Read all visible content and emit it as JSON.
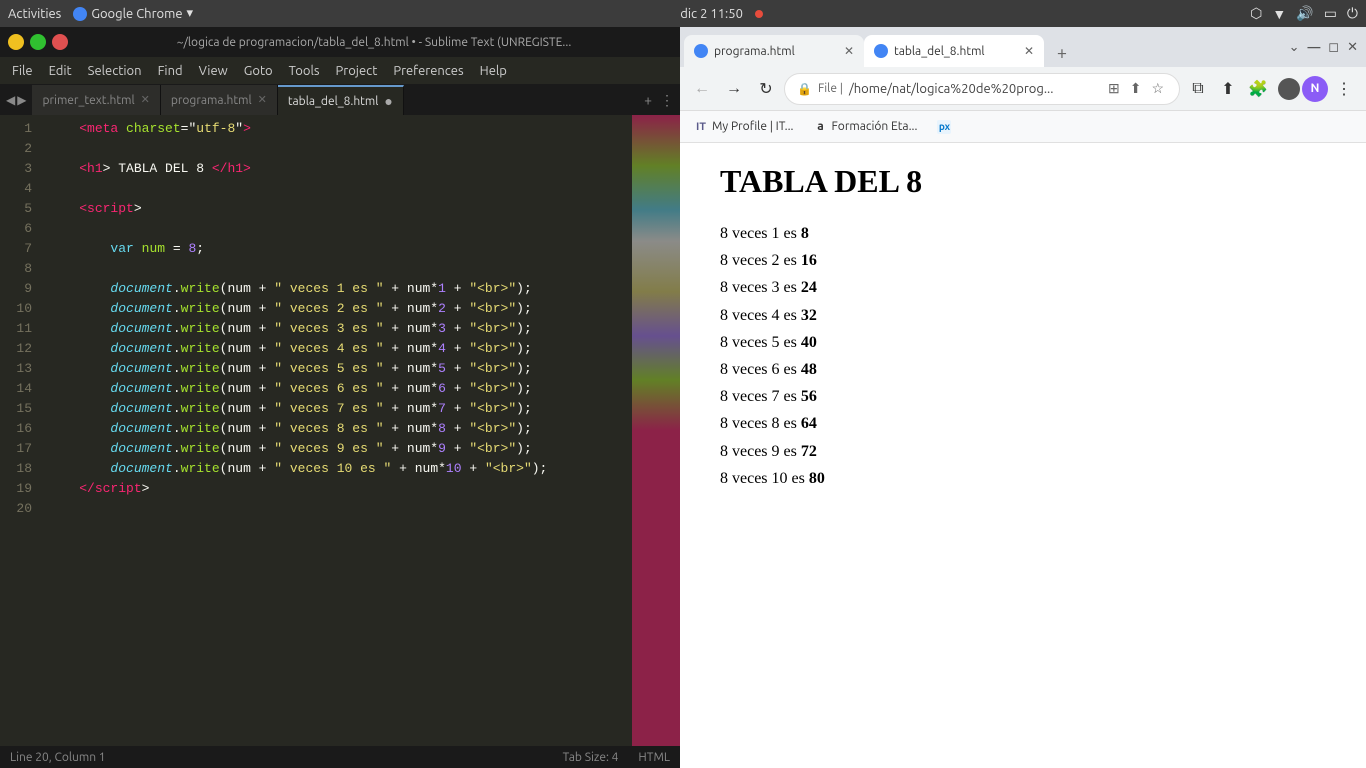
{
  "system_bar": {
    "activities": "Activities",
    "app_name": "Google Chrome",
    "dropdown_icon": "▾",
    "datetime": "dic 2  11:50",
    "icons_right": [
      "dropbox",
      "wifi",
      "volume",
      "screen",
      "power"
    ]
  },
  "sublime": {
    "title": "~/logica de programacion/tabla_del_8.html • - Sublime Text (UNREGISTE...",
    "tabs": [
      {
        "name": "primer_text.html",
        "active": false,
        "unsaved": false
      },
      {
        "name": "programa.html",
        "active": false,
        "unsaved": false
      },
      {
        "name": "tabla_del_8.html",
        "active": true,
        "unsaved": true
      }
    ],
    "menu_items": [
      "File",
      "Edit",
      "Selection",
      "Find",
      "View",
      "Goto",
      "Tools",
      "Project",
      "Preferences",
      "Help"
    ],
    "lines": [
      {
        "num": 1,
        "code": [
          {
            "t": "plain",
            "v": "    "
          },
          {
            "t": "tag",
            "v": "<meta"
          },
          {
            "t": "plain",
            "v": " "
          },
          {
            "t": "attr",
            "v": "charset"
          },
          {
            "t": "plain",
            "v": "=\""
          },
          {
            "t": "str",
            "v": "utf-8"
          },
          {
            "t": "plain",
            "v": "\""
          },
          {
            "t": "tag",
            "v": ">"
          }
        ]
      },
      {
        "num": 2,
        "code": []
      },
      {
        "num": 3,
        "code": [
          {
            "t": "plain",
            "v": "    "
          },
          {
            "t": "tag",
            "v": "<h1"
          },
          {
            "t": "plain",
            "v": "> TABLA DEL 8 "
          },
          {
            "t": "tag",
            "v": "</h1>"
          }
        ]
      },
      {
        "num": 4,
        "code": []
      },
      {
        "num": 5,
        "code": [
          {
            "t": "plain",
            "v": "    "
          },
          {
            "t": "tag",
            "v": "<script"
          },
          {
            "t": "plain",
            "v": ">"
          }
        ]
      },
      {
        "num": 6,
        "code": []
      },
      {
        "num": 7,
        "code": [
          {
            "t": "plain",
            "v": "        "
          },
          {
            "t": "keyword",
            "v": "var"
          },
          {
            "t": "plain",
            "v": " "
          },
          {
            "t": "varname",
            "v": "num"
          },
          {
            "t": "plain",
            "v": " "
          },
          {
            "t": "plain",
            "v": "="
          },
          {
            "t": "plain",
            "v": " "
          },
          {
            "t": "num",
            "v": "8"
          },
          {
            "t": "plain",
            "v": ";"
          }
        ]
      },
      {
        "num": 8,
        "code": []
      },
      {
        "num": 9,
        "code": [
          {
            "t": "plain",
            "v": "        "
          },
          {
            "t": "obj",
            "v": "document"
          },
          {
            "t": "plain",
            "v": "."
          },
          {
            "t": "method",
            "v": "write"
          },
          {
            "t": "plain",
            "v": "(num + "
          },
          {
            "t": "str",
            "v": "\" veces 1 es \""
          },
          {
            "t": "plain",
            "v": " + num*"
          },
          {
            "t": "num",
            "v": "1"
          },
          {
            "t": "plain",
            "v": " + "
          },
          {
            "t": "str",
            "v": "\"<br>\""
          },
          {
            "t": "plain",
            "v": ");"
          }
        ]
      },
      {
        "num": 10,
        "code": [
          {
            "t": "plain",
            "v": "        "
          },
          {
            "t": "obj",
            "v": "document"
          },
          {
            "t": "plain",
            "v": "."
          },
          {
            "t": "method",
            "v": "write"
          },
          {
            "t": "plain",
            "v": "(num + "
          },
          {
            "t": "str",
            "v": "\" veces 2 es \""
          },
          {
            "t": "plain",
            "v": " + num*"
          },
          {
            "t": "num",
            "v": "2"
          },
          {
            "t": "plain",
            "v": " + "
          },
          {
            "t": "str",
            "v": "\"<br>\""
          },
          {
            "t": "plain",
            "v": ");"
          }
        ]
      },
      {
        "num": 11,
        "code": [
          {
            "t": "plain",
            "v": "        "
          },
          {
            "t": "obj",
            "v": "document"
          },
          {
            "t": "plain",
            "v": "."
          },
          {
            "t": "method",
            "v": "write"
          },
          {
            "t": "plain",
            "v": "(num + "
          },
          {
            "t": "str",
            "v": "\" veces 3 es \""
          },
          {
            "t": "plain",
            "v": " + num*"
          },
          {
            "t": "num",
            "v": "3"
          },
          {
            "t": "plain",
            "v": " + "
          },
          {
            "t": "str",
            "v": "\"<br>\""
          },
          {
            "t": "plain",
            "v": ");"
          }
        ]
      },
      {
        "num": 12,
        "code": [
          {
            "t": "plain",
            "v": "        "
          },
          {
            "t": "obj",
            "v": "document"
          },
          {
            "t": "plain",
            "v": "."
          },
          {
            "t": "method",
            "v": "write"
          },
          {
            "t": "plain",
            "v": "(num + "
          },
          {
            "t": "str",
            "v": "\" veces 4 es \""
          },
          {
            "t": "plain",
            "v": " + num*"
          },
          {
            "t": "num",
            "v": "4"
          },
          {
            "t": "plain",
            "v": " + "
          },
          {
            "t": "str",
            "v": "\"<br>\""
          },
          {
            "t": "plain",
            "v": ");"
          }
        ]
      },
      {
        "num": 13,
        "code": [
          {
            "t": "plain",
            "v": "        "
          },
          {
            "t": "obj",
            "v": "document"
          },
          {
            "t": "plain",
            "v": "."
          },
          {
            "t": "method",
            "v": "write"
          },
          {
            "t": "plain",
            "v": "(num + "
          },
          {
            "t": "str",
            "v": "\" veces 5 es \""
          },
          {
            "t": "plain",
            "v": " + num*"
          },
          {
            "t": "num",
            "v": "5"
          },
          {
            "t": "plain",
            "v": " + "
          },
          {
            "t": "str",
            "v": "\"<br>\""
          },
          {
            "t": "plain",
            "v": ");"
          }
        ]
      },
      {
        "num": 14,
        "code": [
          {
            "t": "plain",
            "v": "        "
          },
          {
            "t": "obj",
            "v": "document"
          },
          {
            "t": "plain",
            "v": "."
          },
          {
            "t": "method",
            "v": "write"
          },
          {
            "t": "plain",
            "v": "(num + "
          },
          {
            "t": "str",
            "v": "\" veces 6 es \""
          },
          {
            "t": "plain",
            "v": " + num*"
          },
          {
            "t": "num",
            "v": "6"
          },
          {
            "t": "plain",
            "v": " + "
          },
          {
            "t": "str",
            "v": "\"<br>\""
          },
          {
            "t": "plain",
            "v": ");"
          }
        ]
      },
      {
        "num": 15,
        "code": [
          {
            "t": "plain",
            "v": "        "
          },
          {
            "t": "obj",
            "v": "document"
          },
          {
            "t": "plain",
            "v": "."
          },
          {
            "t": "method",
            "v": "write"
          },
          {
            "t": "plain",
            "v": "(num + "
          },
          {
            "t": "str",
            "v": "\" veces 7 es \""
          },
          {
            "t": "plain",
            "v": " + num*"
          },
          {
            "t": "num",
            "v": "7"
          },
          {
            "t": "plain",
            "v": " + "
          },
          {
            "t": "str",
            "v": "\"<br>\""
          },
          {
            "t": "plain",
            "v": ");"
          }
        ]
      },
      {
        "num": 16,
        "code": [
          {
            "t": "plain",
            "v": "        "
          },
          {
            "t": "obj",
            "v": "document"
          },
          {
            "t": "plain",
            "v": "."
          },
          {
            "t": "method",
            "v": "write"
          },
          {
            "t": "plain",
            "v": "(num + "
          },
          {
            "t": "str",
            "v": "\" veces 8 es \""
          },
          {
            "t": "plain",
            "v": " + num*"
          },
          {
            "t": "num",
            "v": "8"
          },
          {
            "t": "plain",
            "v": " + "
          },
          {
            "t": "str",
            "v": "\"<br>\""
          },
          {
            "t": "plain",
            "v": ");"
          }
        ]
      },
      {
        "num": 17,
        "code": [
          {
            "t": "plain",
            "v": "        "
          },
          {
            "t": "obj",
            "v": "document"
          },
          {
            "t": "plain",
            "v": "."
          },
          {
            "t": "method",
            "v": "write"
          },
          {
            "t": "plain",
            "v": "(num + "
          },
          {
            "t": "str",
            "v": "\" veces 9 es \""
          },
          {
            "t": "plain",
            "v": " + num*"
          },
          {
            "t": "num",
            "v": "9"
          },
          {
            "t": "plain",
            "v": " + "
          },
          {
            "t": "str",
            "v": "\"<br>\""
          },
          {
            "t": "plain",
            "v": ");"
          }
        ]
      },
      {
        "num": 18,
        "code": [
          {
            "t": "plain",
            "v": "        "
          },
          {
            "t": "obj",
            "v": "document"
          },
          {
            "t": "plain",
            "v": "."
          },
          {
            "t": "method",
            "v": "write"
          },
          {
            "t": "plain",
            "v": "(num + "
          },
          {
            "t": "str",
            "v": "\" veces 10 es \""
          },
          {
            "t": "plain",
            "v": " + num*"
          },
          {
            "t": "num",
            "v": "10"
          },
          {
            "t": "plain",
            "v": " + "
          },
          {
            "t": "str",
            "v": "\"<br>\""
          },
          {
            "t": "plain",
            "v": ");"
          }
        ]
      },
      {
        "num": 19,
        "code": [
          {
            "t": "plain",
            "v": "    "
          },
          {
            "t": "tag",
            "v": "</script"
          },
          {
            "t": "plain",
            "v": ">"
          }
        ]
      },
      {
        "num": 20,
        "code": []
      }
    ],
    "status": {
      "position": "Line 20, Column 1",
      "tab_size": "Tab Size: 4",
      "syntax": "HTML"
    }
  },
  "chrome": {
    "tabs": [
      {
        "id": "tab1",
        "title": "programa.html",
        "favicon_color": "#4285f4",
        "active": false
      },
      {
        "id": "tab2",
        "title": "tabla_del_8.html",
        "favicon_color": "#4285f4",
        "active": true
      }
    ],
    "address": "/home/nat/logica%20de%20prog...",
    "address_full": "File | /home/nat/logica%20de%20prog...",
    "bookmarks": [
      {
        "label": "My Profile | IT...",
        "type": "it"
      },
      {
        "label": "Formación Eta...",
        "type": "a"
      },
      {
        "label": "px",
        "type": "px"
      }
    ],
    "page": {
      "title": "TABLA DEL 8",
      "rows": [
        "8 veces 1 es 8",
        "8 veces 2 es 16",
        "8 veces 3 es 24",
        "8 veces 4 es 32",
        "8 veces 5 es 40",
        "8 veces 6 es 48",
        "8 veces 7 es 56",
        "8 veces 8 es 64",
        "8 veces 9 es 72",
        "8 veces 10 es 80"
      ]
    }
  }
}
